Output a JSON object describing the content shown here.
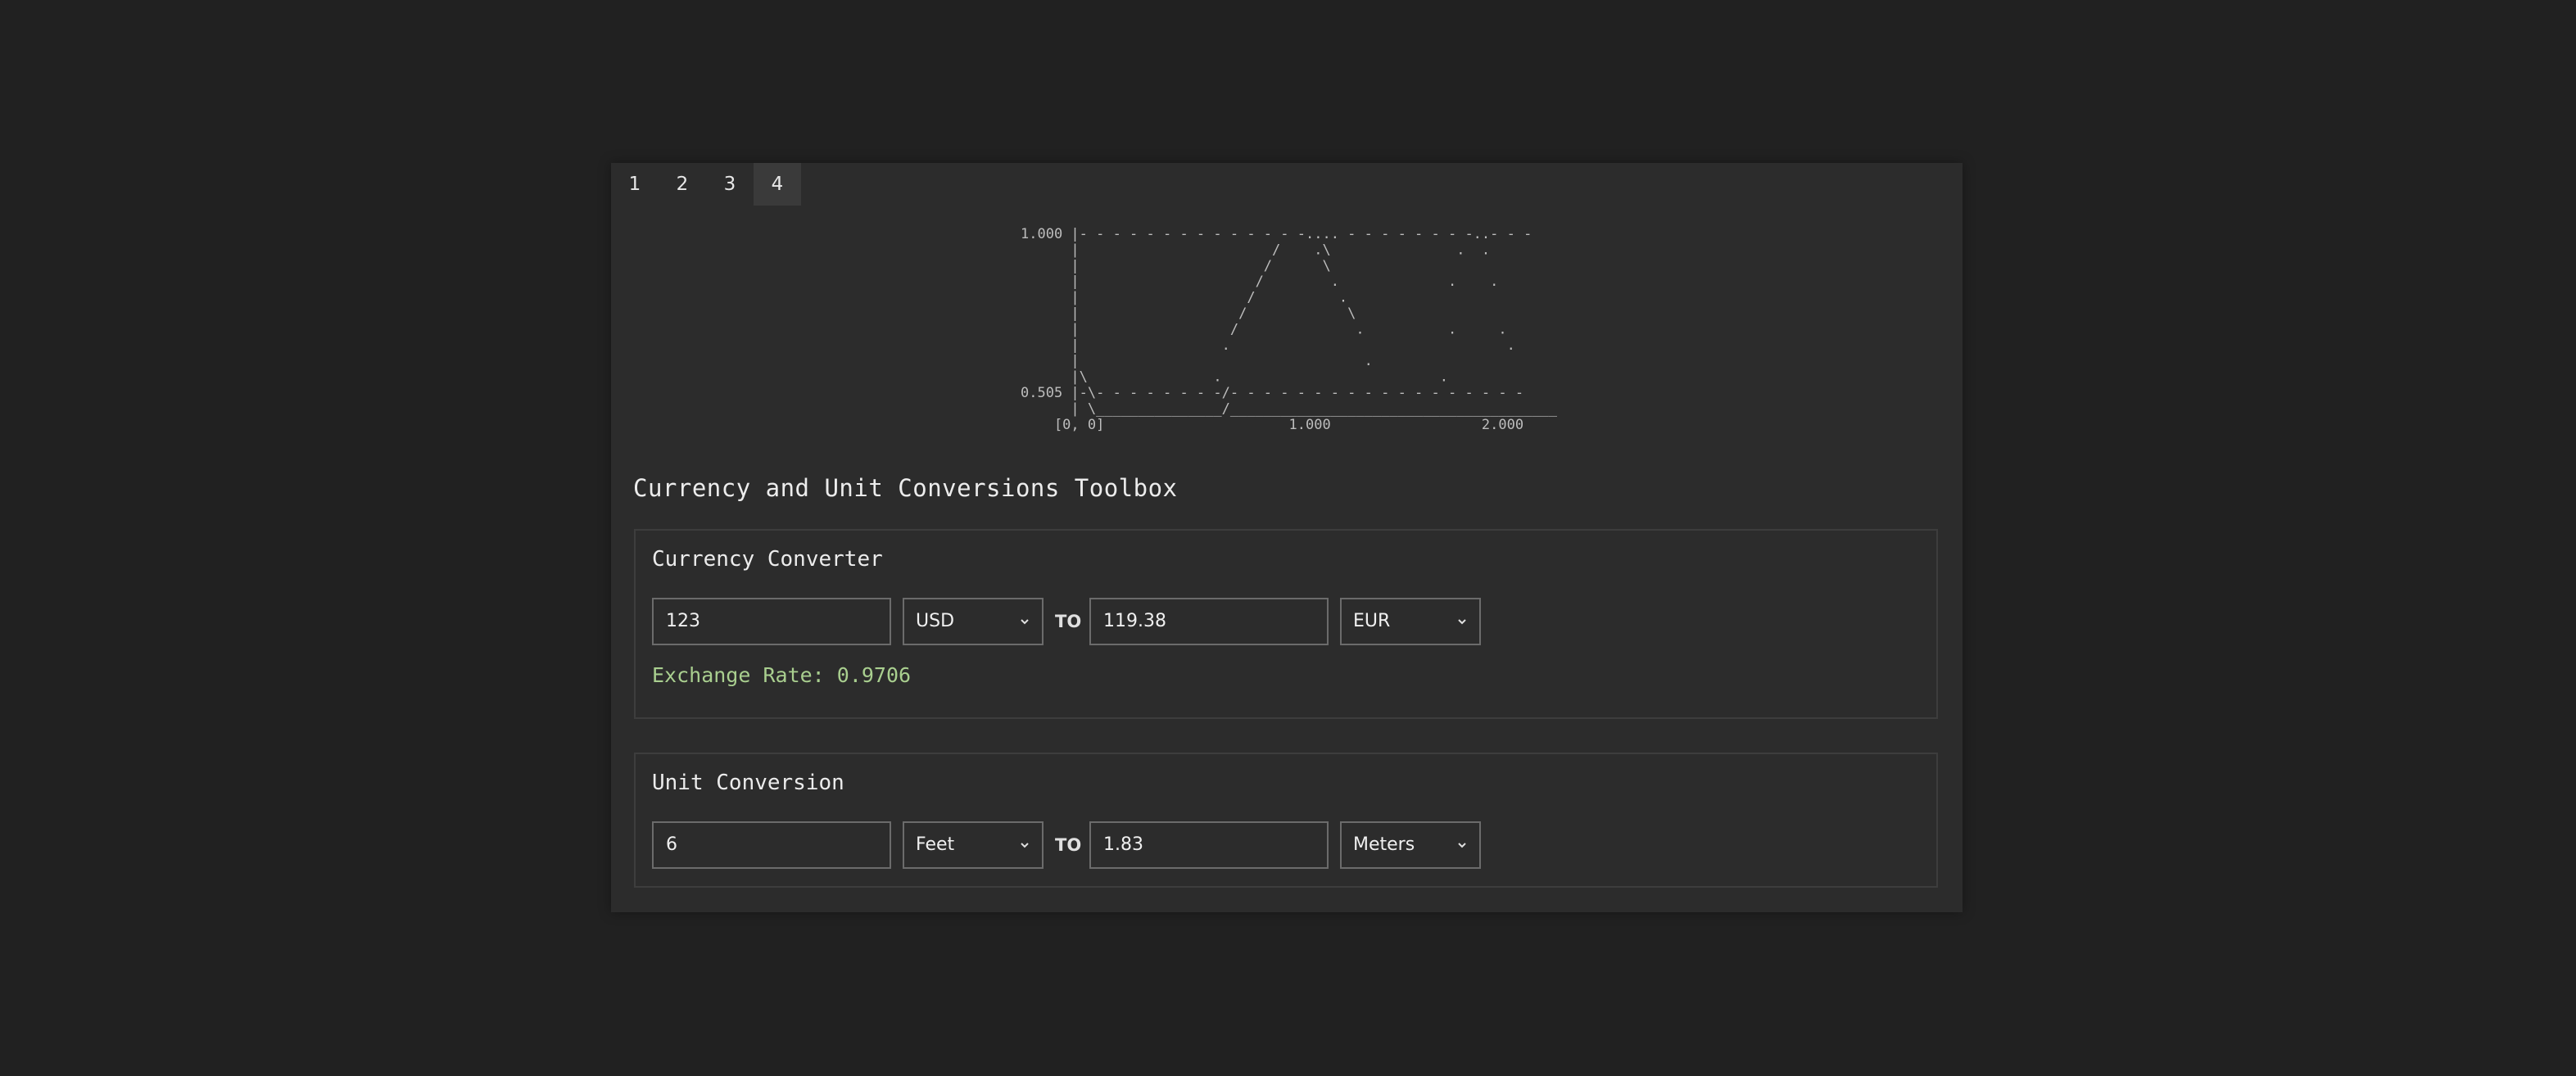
{
  "tabs": [
    {
      "label": "1",
      "active": false
    },
    {
      "label": "2",
      "active": false
    },
    {
      "label": "3",
      "active": false
    },
    {
      "label": "4",
      "active": true
    }
  ],
  "ascii_chart": {
    "lines": [
      "1.000 |- - - - - - - - - - - - - -.... - - - - - - - -..- - -",
      "      |                       /    .\\               .  .",
      "      |                      /      \\",
      "      |                     /        .             .    .",
      "      |                    /          .",
      "      |                   /            \\",
      "      |                  /              .          .     .",
      "      |                 .                                 .",
      "      |                                  .",
      "      |\\               .                          .",
      "0.505 |-\\- - - - - - - -/- - - - - - - - - - - - - - - - - -",
      "      | \\_______________/_______________________________________",
      "    [0, 0]                      1.000                  2.000"
    ]
  },
  "page": {
    "title": "Currency and Unit Conversions Toolbox"
  },
  "currency": {
    "title": "Currency Converter",
    "from_value": "123",
    "from_unit": "USD",
    "to_label": "TO",
    "to_value": "119.38",
    "to_unit": "EUR",
    "rate_text": "Exchange Rate: 0.9706",
    "rate_color": "#a9cf8f"
  },
  "unit": {
    "title": "Unit Conversion",
    "from_value": "6",
    "from_unit": "Feet",
    "to_label": "TO",
    "to_value": "1.83",
    "to_unit": "Meters"
  }
}
